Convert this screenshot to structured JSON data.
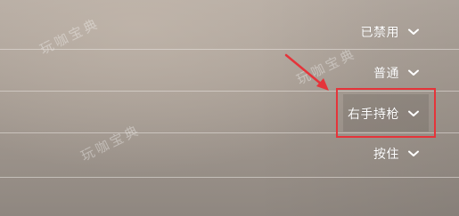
{
  "options": [
    {
      "label": "已禁用"
    },
    {
      "label": "普通"
    },
    {
      "label": "右手持枪"
    },
    {
      "label": "按住"
    }
  ],
  "watermark": {
    "text": "玩咖宝典"
  },
  "icons": {
    "dropdown": "chevron-down-icon",
    "annotation": "red-arrow"
  },
  "colors": {
    "highlight": "#e5343a",
    "text": "#ffffff"
  }
}
